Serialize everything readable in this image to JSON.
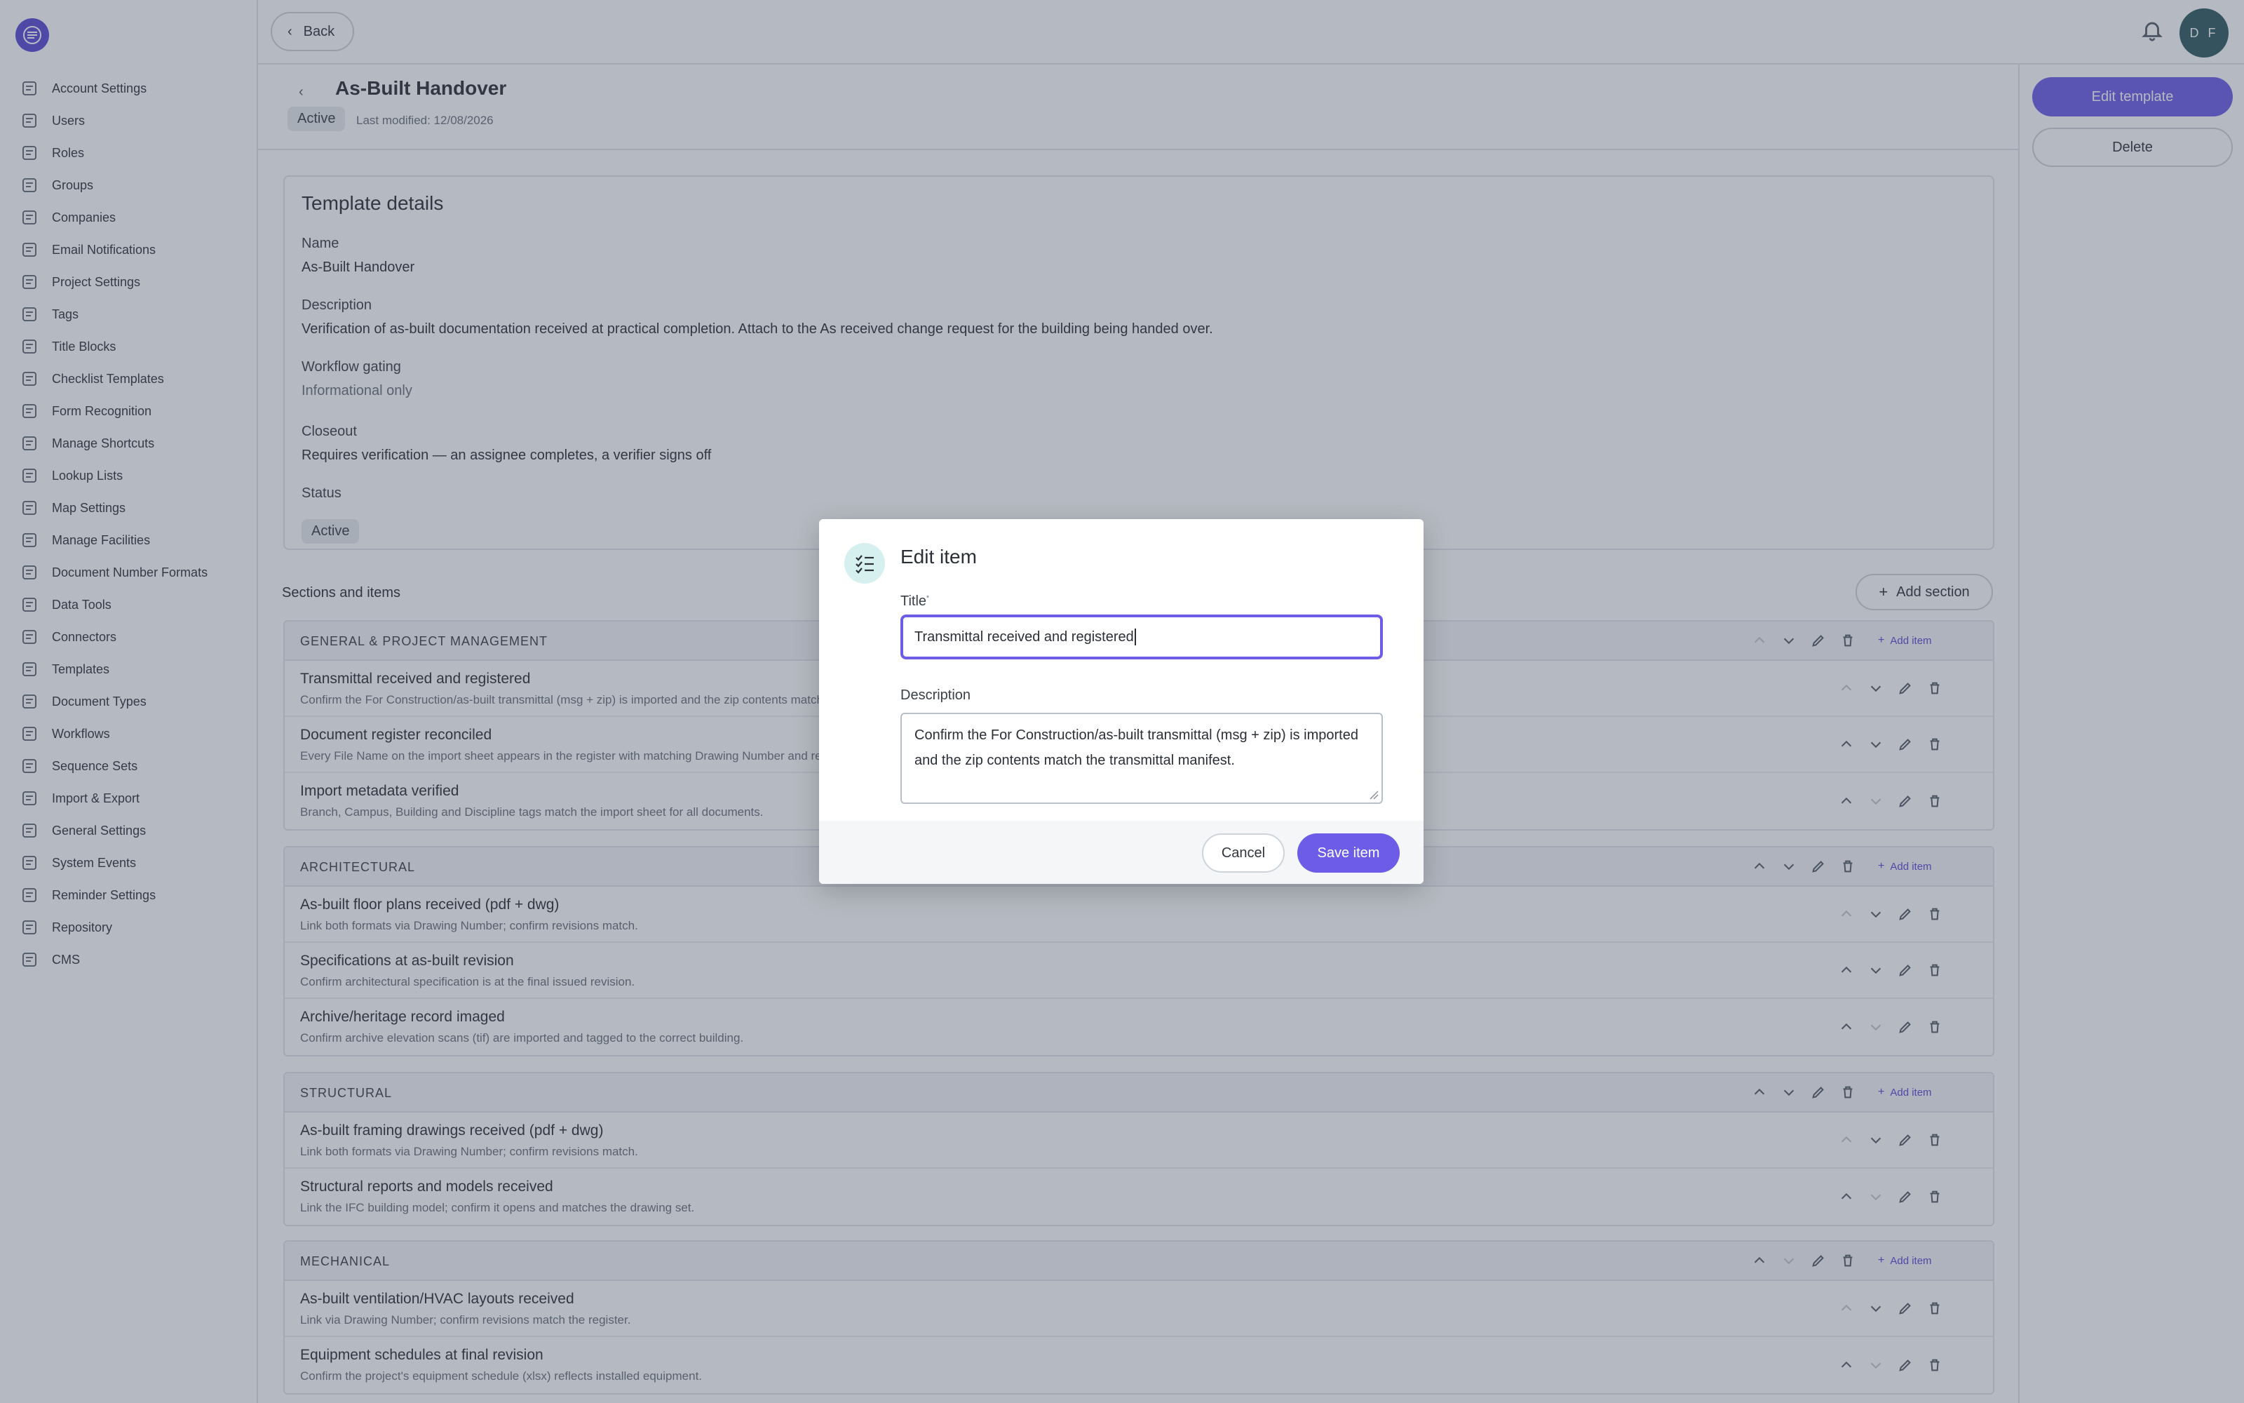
{
  "colors": {
    "accent": "#6c5ce7",
    "overlay": "rgba(60,72,92,0.38)",
    "avatar_bg": "#2f5b5f"
  },
  "topbar": {
    "back_label": "Back",
    "avatar_initials": "D F"
  },
  "sidebar": {
    "items": [
      {
        "label": "Account Settings",
        "icon": "building-icon"
      },
      {
        "label": "Users",
        "icon": "user-icon"
      },
      {
        "label": "Roles",
        "icon": "roles-icon"
      },
      {
        "label": "Groups",
        "icon": "group-icon"
      },
      {
        "label": "Companies",
        "icon": "companies-icon"
      },
      {
        "label": "Email Notifications",
        "icon": "mail-icon"
      },
      {
        "label": "Project Settings",
        "icon": "folder-icon"
      },
      {
        "label": "Tags",
        "icon": "tag-icon"
      },
      {
        "label": "Title Blocks",
        "icon": "list-icon"
      },
      {
        "label": "Checklist Templates",
        "icon": "check-circle-icon"
      },
      {
        "label": "Form Recognition",
        "icon": "doc-search-icon"
      },
      {
        "label": "Manage Shortcuts",
        "icon": "shortcut-icon"
      },
      {
        "label": "Lookup Lists",
        "icon": "stack-icon"
      },
      {
        "label": "Map Settings",
        "icon": "map-icon"
      },
      {
        "label": "Manage Facilities",
        "icon": "facility-icon"
      },
      {
        "label": "Document Number Formats",
        "icon": "doc-number-icon"
      },
      {
        "label": "Data Tools",
        "icon": "database-icon"
      },
      {
        "label": "Connectors",
        "icon": "grid-icon"
      },
      {
        "label": "Templates",
        "icon": "template-icon"
      },
      {
        "label": "Document Types",
        "icon": "doc-types-icon"
      },
      {
        "label": "Workflows",
        "icon": "workflow-icon"
      },
      {
        "label": "Sequence Sets",
        "icon": "sequence-icon"
      },
      {
        "label": "Import & Export",
        "icon": "import-export-icon"
      },
      {
        "label": "General Settings",
        "icon": "gear-icon"
      },
      {
        "label": "System Events",
        "icon": "clipboard-icon"
      },
      {
        "label": "Reminder Settings",
        "icon": "alarm-icon"
      },
      {
        "label": "Repository",
        "icon": "repository-icon"
      },
      {
        "label": "CMS",
        "icon": "file-icon"
      }
    ]
  },
  "page": {
    "title": "As-Built Handover",
    "status": "Active",
    "last_modified": "Last modified: 12/08/2026"
  },
  "rail": {
    "edit_label": "Edit template",
    "delete_label": "Delete"
  },
  "details": {
    "heading": "Template details",
    "name_label": "Name",
    "name_value": "As-Built Handover",
    "desc_label": "Description",
    "desc_value": "Verification of as-built documentation received at practical completion. Attach to the As received change request for the building being handed over.",
    "gating_label": "Workflow gating",
    "gating_value": "Informational only",
    "closeout_label": "Closeout",
    "closeout_value": "Requires verification — an assignee completes, a verifier signs off",
    "status_label": "Status",
    "status_value": "Active"
  },
  "sections_heading": "Sections and items",
  "add_section_label": "Add section",
  "add_item_label": "Add item",
  "sections": [
    {
      "name": "GENERAL & PROJECT MANAGEMENT",
      "items": [
        {
          "title": "Transmittal received and registered",
          "desc": "Confirm the For Construction/as-built transmittal (msg + zip) is imported and the zip contents match the transmittal manifest."
        },
        {
          "title": "Document register reconciled",
          "desc": "Every File Name on the import sheet appears in the register with matching Drawing Number and revision."
        },
        {
          "title": "Import metadata verified",
          "desc": "Branch, Campus, Building and Discipline tags match the import sheet for all documents."
        }
      ]
    },
    {
      "name": "ARCHITECTURAL",
      "items": [
        {
          "title": "As-built floor plans received (pdf + dwg)",
          "desc": "Link both formats via Drawing Number; confirm revisions match."
        },
        {
          "title": "Specifications at as-built revision",
          "desc": "Confirm architectural specification is at the final issued revision."
        },
        {
          "title": "Archive/heritage record imaged",
          "desc": "Confirm archive elevation scans (tif) are imported and tagged to the correct building."
        }
      ]
    },
    {
      "name": "STRUCTURAL",
      "items": [
        {
          "title": "As-built framing drawings received (pdf + dwg)",
          "desc": "Link both formats via Drawing Number; confirm revisions match."
        },
        {
          "title": "Structural reports and models received",
          "desc": "Link the IFC building model; confirm it opens and matches the drawing set."
        }
      ]
    },
    {
      "name": "MECHANICAL",
      "items": [
        {
          "title": "As-built ventilation/HVAC layouts received",
          "desc": "Link via Drawing Number; confirm revisions match the register."
        },
        {
          "title": "Equipment schedules at final revision",
          "desc": "Confirm the project's equipment schedule (xlsx) reflects installed equipment."
        }
      ]
    }
  ],
  "modal": {
    "title": "Edit item",
    "title_label": "Title",
    "required_mark": "*",
    "title_value": "Transmittal received and registered",
    "desc_label": "Description",
    "desc_value": "Confirm the For Construction/as-built transmittal (msg + zip) is imported and the zip contents match the transmittal manifest.",
    "cancel_label": "Cancel",
    "save_label": "Save item"
  }
}
